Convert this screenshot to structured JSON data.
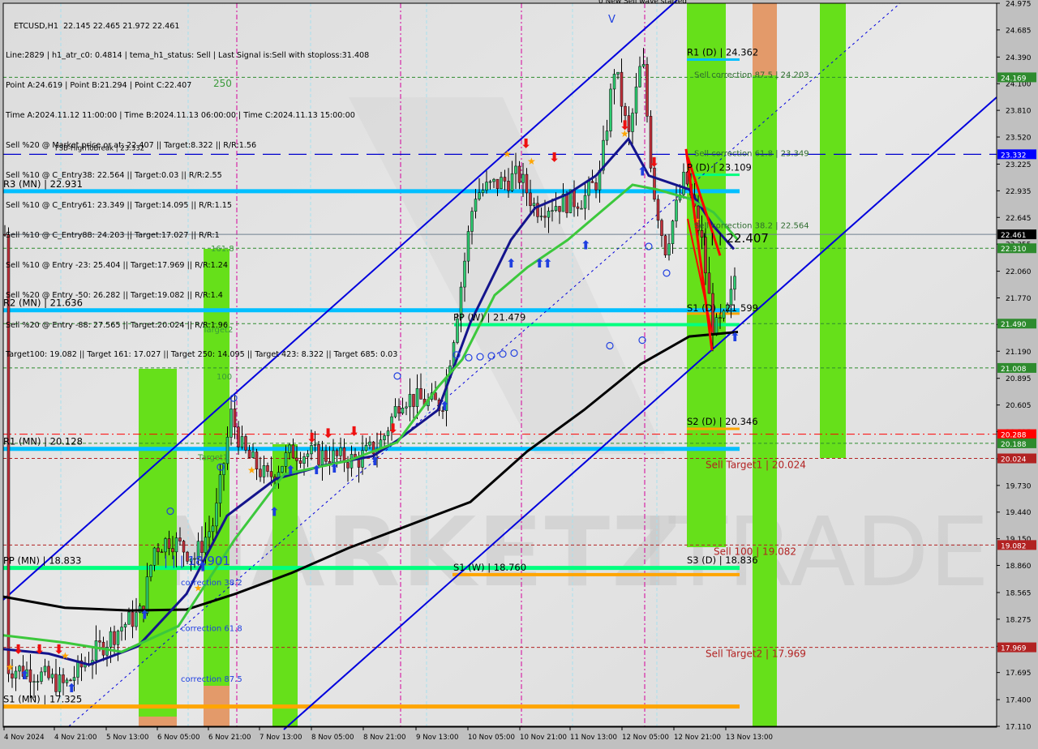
{
  "header": {
    "symbol_line": "ETCUSD,H1  22.145 22.465 21.972 22.461",
    "info_lines": [
      "Line:2829 | h1_atr_c0: 0.4814 | tema_h1_status: Sell | Last Signal is:Sell with stoploss:31.408",
      "Point A:24.619 | Point B:21.294 | Point C:22.407",
      "Time A:2024.11.12 11:00:00 | Time B:2024.11.13 06:00:00 | Time C:2024.11.13 15:00:00",
      "Sell %20 @ Market price or at: 22.407 || Target:8.322 || R/R:1.56",
      "Sell %10 @ C_Entry38: 22.564 || Target:0.03 || R/R:2.55",
      "Sell %10 @ C_Entry61: 23.349 || Target:14.095 || R/R:1.15",
      "Sell %10 @ C_Entry88: 24.203 || Target:17.027 || R/R:1",
      "Sell %10 @ Entry -23: 25.404 || Target:17.969 || R/R:1.24",
      "Sell %20 @ Entry -50: 26.282 || Target:19.082 || R/R:1.4",
      "Sell %20 @ Entry -88: 27.565 || Target:20.024 || R/R:1.96",
      "Target100: 19.082 || Target 161: 17.027 || Target 250: 14.095 || Target 423: 8.322 || Target 685: 0.03"
    ],
    "top_banner": "0 New Sell wave started"
  },
  "chart_data": {
    "type": "candlestick",
    "title": "ETCUSD,H1",
    "ohlc_last": {
      "open": 22.145,
      "high": 22.465,
      "low": 21.972,
      "close": 22.461
    },
    "ylim": [
      17.11,
      24.975
    ],
    "y_ticks": [
      "24.975",
      "24.685",
      "24.390",
      "24.100",
      "23.810",
      "23.520",
      "23.225",
      "22.935",
      "22.645",
      "22.355",
      "22.060",
      "21.770",
      "21.480",
      "21.190",
      "20.895",
      "20.605",
      "20.315",
      "20.020",
      "19.730",
      "19.440",
      "19.150",
      "18.860",
      "18.565",
      "18.275",
      "17.980",
      "17.695",
      "17.400",
      "17.110"
    ],
    "x_ticks": [
      "4 Nov 2024",
      "4 Nov 21:00",
      "5 Nov 13:00",
      "6 Nov 05:00",
      "6 Nov 21:00",
      "7 Nov 13:00",
      "8 Nov 05:00",
      "8 Nov 21:00",
      "9 Nov 13:00",
      "10 Nov 05:00",
      "10 Nov 21:00",
      "11 Nov 13:00",
      "12 Nov 05:00",
      "12 Nov 21:00",
      "13 Nov 13:00"
    ],
    "price_badges": [
      {
        "value": "24.169",
        "color": "#2e8b2e"
      },
      {
        "value": "23.332",
        "color": "#0000ff"
      },
      {
        "value": "22.461",
        "color": "#000000"
      },
      {
        "value": "22.310",
        "color": "#2e8b2e"
      },
      {
        "value": "21.490",
        "color": "#2e8b2e"
      },
      {
        "value": "21.008",
        "color": "#2e8b2e"
      },
      {
        "value": "20.288",
        "color": "#ff0000"
      },
      {
        "value": "20.188",
        "color": "#2e8b2e"
      },
      {
        "value": "20.024",
        "color": "#b22222"
      },
      {
        "value": "19.082",
        "color": "#b22222"
      },
      {
        "value": "17.969",
        "color": "#b22222"
      }
    ],
    "levels": [
      {
        "label": "R3 (MN) | 22.931",
        "price": 22.931,
        "color": "#00bfff",
        "style": "thick"
      },
      {
        "label": "R2 (MN) | 21.636",
        "price": 21.636,
        "color": "#00bfff",
        "style": "thick"
      },
      {
        "label": "R1 (MN) | 20.128",
        "price": 20.128,
        "color": "#00bfff",
        "style": "thick"
      },
      {
        "label": "PP (MN) | 18.833",
        "price": 18.833,
        "color": "#00ff7f",
        "style": "thick"
      },
      {
        "label": "S1 (MN) | 17.325",
        "price": 17.325,
        "color": "#ffa500",
        "style": "thick"
      },
      {
        "label": "FSB-HighToBreak | 23.332",
        "price": 23.332,
        "color": "#0000cd",
        "style": "longdash"
      },
      {
        "label": "R1 (D) | 24.362",
        "price": 24.362,
        "color": "#00bfff",
        "style": "short"
      },
      {
        "label": "P (D) | 23.109",
        "price": 23.109,
        "color": "#00ff7f",
        "style": "short"
      },
      {
        "label": "S2 (D) | 20.346",
        "price": 20.346,
        "color": "#ffa500",
        "style": "short"
      },
      {
        "label": "S3 (D) | 18.836",
        "price": 18.836,
        "color": "#00ff7f",
        "style": "short"
      },
      {
        "label": "PP (W) | 21.479",
        "price": 21.479,
        "color": "#00ff7f",
        "style": "thick"
      },
      {
        "label": "S1 (W) | 18.760",
        "price": 18.76,
        "color": "#ffa500",
        "style": "thick"
      },
      {
        "label": "S1 (D) | 21.599",
        "price": 21.599,
        "color": "#ffa500",
        "style": "short"
      }
    ],
    "annotations": [
      {
        "text": "Sell correction 87.5 | 24.203",
        "price": 24.203
      },
      {
        "text": "Sell correction 61.8 | 23.349",
        "price": 23.349
      },
      {
        "text": "Sell correction 38.2 | 22.564",
        "price": 22.564
      },
      {
        "text": "| | | 22.407",
        "price": 22.407
      },
      {
        "text": "Sell Target1 | 20.024",
        "price": 20.024
      },
      {
        "text": "Sell 100 | 19.082",
        "price": 19.082
      },
      {
        "text": "Sell Target2 | 17.969",
        "price": 17.969
      },
      {
        "text": "| | | 18.901",
        "price": 18.901
      },
      {
        "text": "correction 38.2",
        "price": 18.68
      },
      {
        "text": "correction 61.8",
        "price": 18.18
      },
      {
        "text": "correction 87.5",
        "price": 17.63
      },
      {
        "text": "250",
        "price": 24.1
      },
      {
        "text": "161.8",
        "price": 22.31
      },
      {
        "text": "Target2",
        "price": 21.43
      },
      {
        "text": "100",
        "price": 20.92
      },
      {
        "text": "Target1",
        "price": 20.04
      },
      {
        "text": "V",
        "price": 24.8
      }
    ],
    "watermark": "MARKETZITRADE"
  }
}
